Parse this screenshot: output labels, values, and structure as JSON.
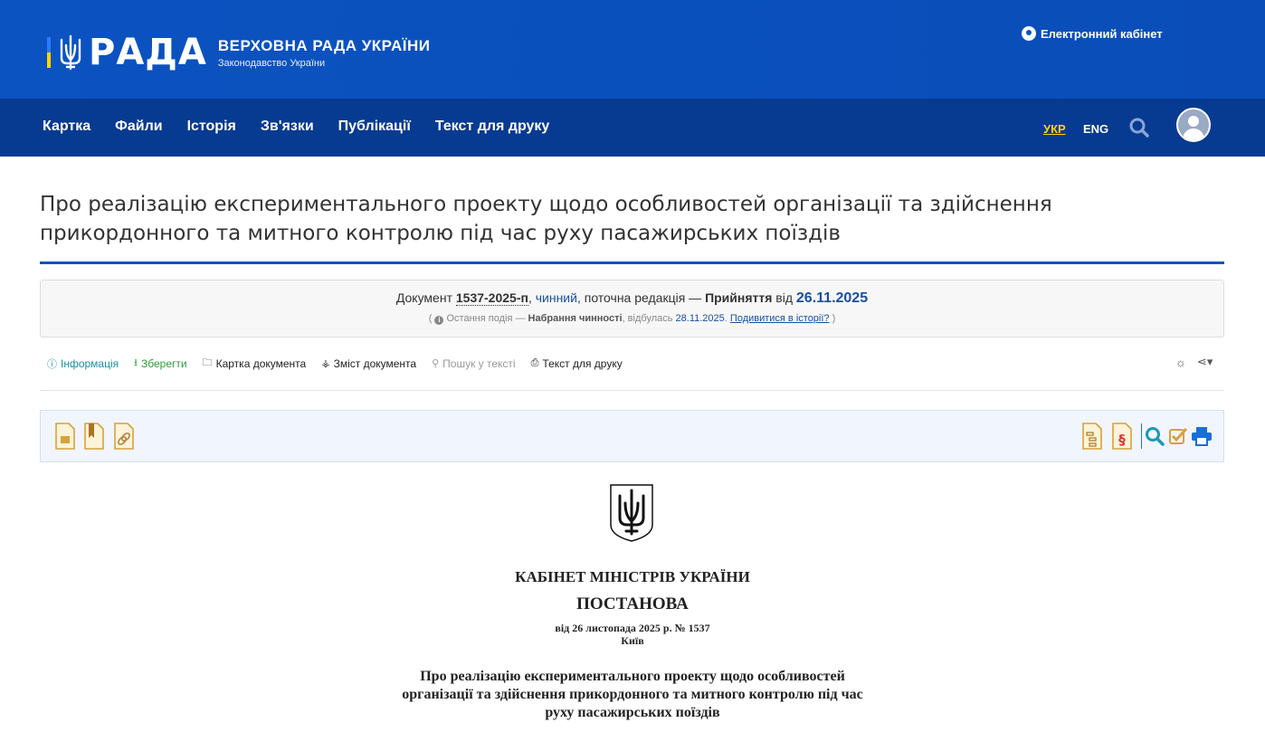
{
  "header": {
    "logo_text": "РАДА",
    "org_title": "ВЕРХОВНА РАДА УКРАЇНИ",
    "org_subtitle": "Законодавство України",
    "cabinet_link": "Електронний кабінет",
    "colors": {
      "brand_blue": "#0b53c1",
      "nav_blue": "#073a91",
      "flag_yellow": "#ffd500"
    }
  },
  "nav": {
    "items": [
      "Картка",
      "Файли",
      "Історія",
      "Зв'язки",
      "Публікації",
      "Текст для друку"
    ],
    "lang_ukr": "УКР",
    "lang_eng": "ENG",
    "search_icon": "search-icon",
    "avatar_icon": "user-avatar-icon"
  },
  "document": {
    "title": "Про реалізацію експериментального проекту щодо особливостей організації та здійснення прикордонного та митного контролю під час руху пасажирських поїздів"
  },
  "info_panel": {
    "doc_label": "Документ",
    "doc_number": "1537-2025-п",
    "status": "чинний",
    "edition_text": ", поточна редакція —",
    "adoption_label": "Прийняття",
    "from_word": "від",
    "adoption_date": "26.11.2025",
    "last_event_label": "Остання подія —",
    "last_event_name": "Набрання чинності",
    "occurred_text": ", відбулась",
    "event_date": "28.11.2025",
    "history_link": "Подивитися в історії?"
  },
  "doc_tabs": {
    "info": "Інформація",
    "save": "Зберегти",
    "card": "Картка документа",
    "contents": "Зміст документа",
    "search_text": "Пошук у тексті",
    "print_text": "Текст для друку"
  },
  "document_body": {
    "org": "КАБІНЕТ МІНІСТРІВ УКРАЇНИ",
    "kind": "ПОСТАНОВА",
    "date_number": "від 26 листопада 2025 р. № 1537",
    "city": "Київ",
    "subject": "Про реалізацію експериментального проекту щодо особливостей організації та здійснення прикордонного та митного контролю під час руху пасажирських поїздів"
  }
}
